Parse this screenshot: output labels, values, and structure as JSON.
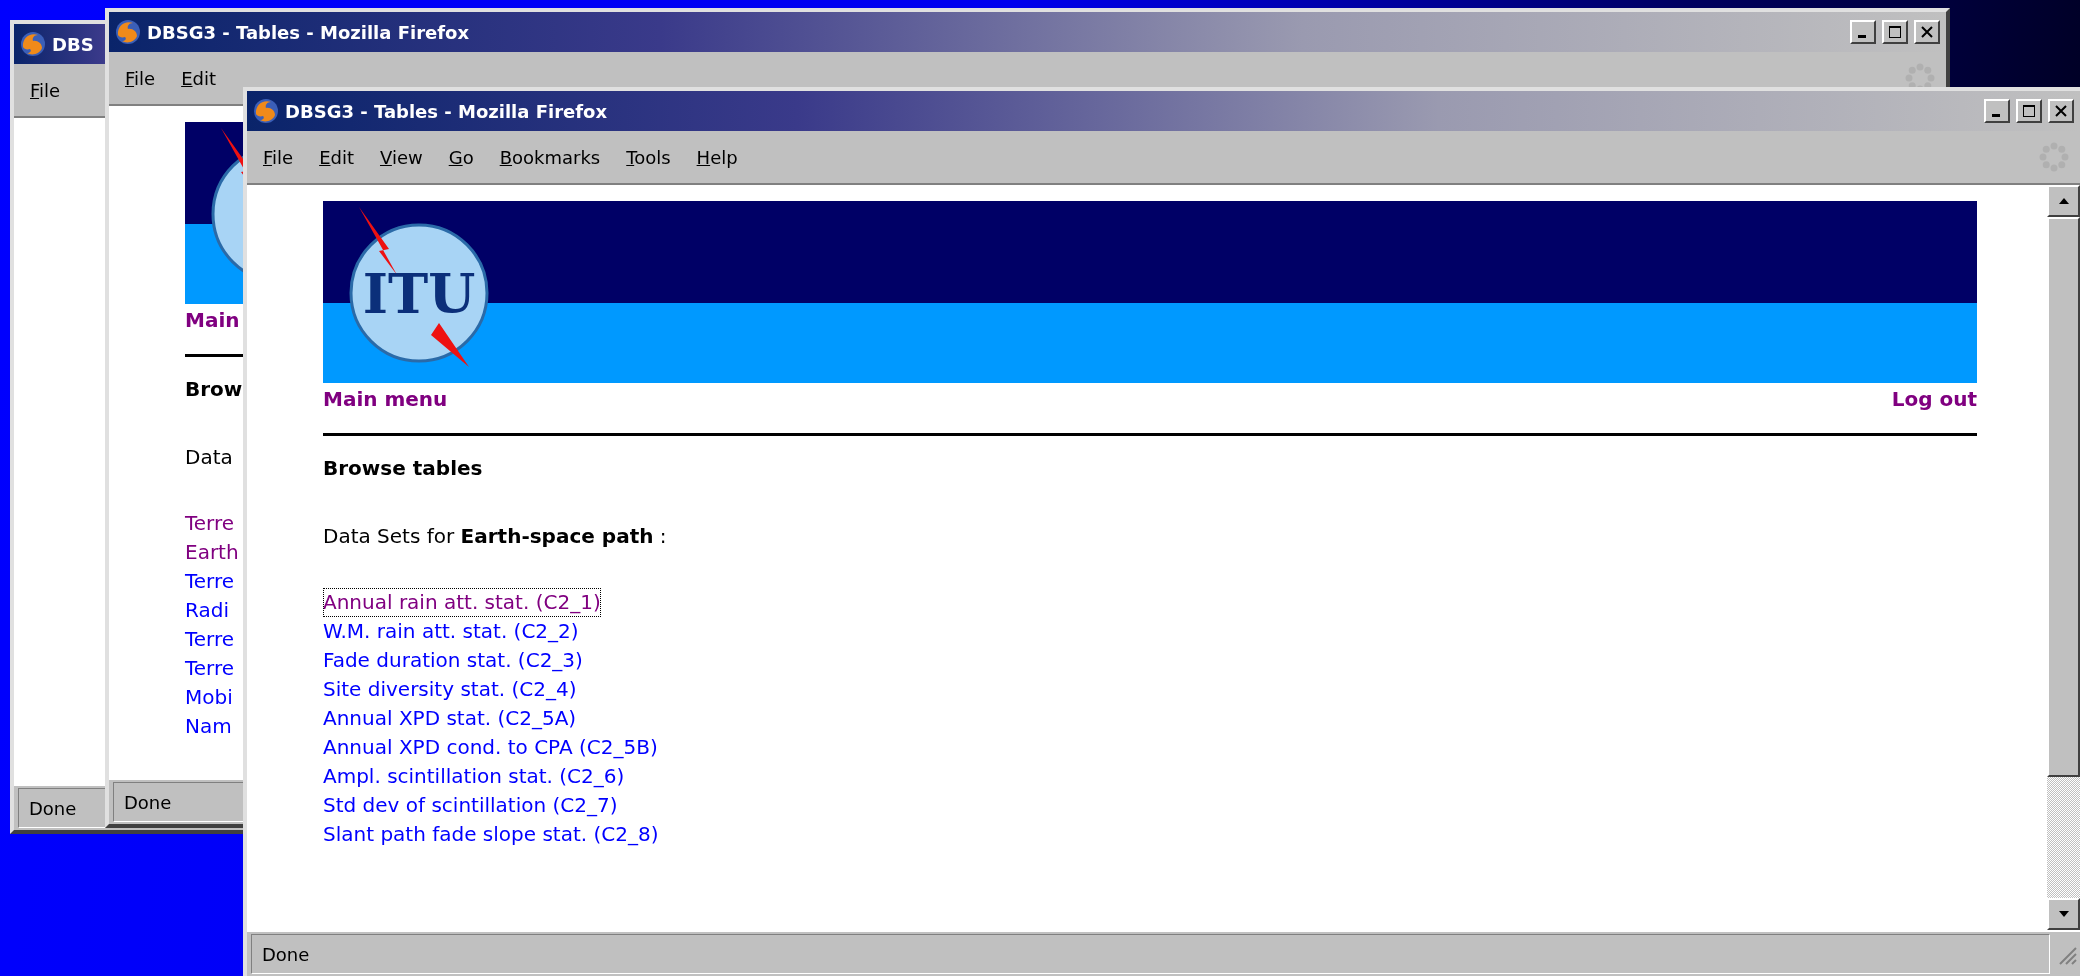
{
  "windows": [
    {
      "title": "DBS",
      "menu": [
        "File"
      ],
      "status": "Done"
    },
    {
      "title": "DBSG3 - Tables - Mozilla Firefox",
      "menu": [
        "File",
        "Edit"
      ],
      "status": "Done",
      "page": {
        "nav_left": "Main",
        "heading": "Brow",
        "intro": "Data",
        "links": [
          {
            "label": "Terre",
            "visited": true,
            "focused": false
          },
          {
            "label": "Earth",
            "visited": true,
            "focused": false
          },
          {
            "label": "Terre",
            "visited": false,
            "focused": false
          },
          {
            "label": "Radi",
            "visited": false,
            "focused": false
          },
          {
            "label": "Terre",
            "visited": false,
            "focused": false
          },
          {
            "label": "Terre",
            "visited": false,
            "focused": false
          },
          {
            "label": "Mobi",
            "visited": false,
            "focused": false
          },
          {
            "label": "Nam",
            "visited": false,
            "focused": false
          }
        ]
      }
    },
    {
      "title": "DBSG3 - Tables - Mozilla Firefox",
      "menu": [
        "File",
        "Edit",
        "View",
        "Go",
        "Bookmarks",
        "Tools",
        "Help"
      ],
      "status": "Done",
      "page": {
        "logo_text": "ITU",
        "nav_left": "Main menu",
        "nav_right": "Log out",
        "heading": "Browse tables",
        "intro": "Data Sets for **Earth-space path** :",
        "links": [
          {
            "label": "Annual rain att. stat. (C2_1)",
            "visited": true,
            "focused": true
          },
          {
            "label": "W.M. rain att. stat. (C2_2)",
            "visited": false,
            "focused": false
          },
          {
            "label": "Fade duration stat. (C2_3)",
            "visited": false,
            "focused": false
          },
          {
            "label": "Site diversity stat. (C2_4)",
            "visited": false,
            "focused": false
          },
          {
            "label": "Annual XPD stat. (C2_5A)",
            "visited": false,
            "focused": false
          },
          {
            "label": "Annual XPD cond. to CPA (C2_5B)",
            "visited": false,
            "focused": false
          },
          {
            "label": "Ampl. scintillation stat. (C2_6)",
            "visited": false,
            "focused": false
          },
          {
            "label": "Std dev of scintillation (C2_7)",
            "visited": false,
            "focused": false
          },
          {
            "label": "Slant path fade slope stat. (C2_8)",
            "visited": false,
            "focused": false
          }
        ]
      }
    }
  ]
}
